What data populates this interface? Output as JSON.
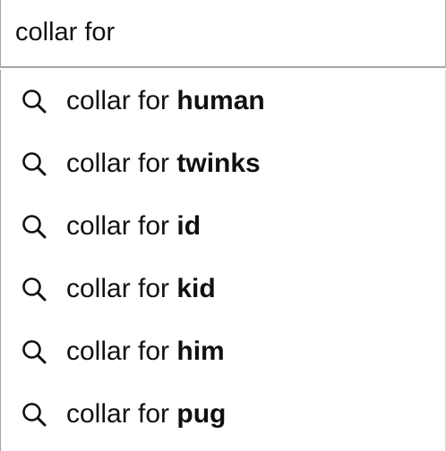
{
  "search": {
    "value": "collar for",
    "placeholder": ""
  },
  "suggestions": [
    {
      "prefix": "collar for ",
      "completion": "human",
      "icon": "search-icon"
    },
    {
      "prefix": "collar for ",
      "completion": "twinks",
      "icon": "search-icon"
    },
    {
      "prefix": "collar for ",
      "completion": "id",
      "icon": "search-icon"
    },
    {
      "prefix": "collar for ",
      "completion": "kid",
      "icon": "search-icon"
    },
    {
      "prefix": "collar for ",
      "completion": "him",
      "icon": "search-icon"
    },
    {
      "prefix": "collar for ",
      "completion": "pug",
      "icon": "search-icon"
    }
  ],
  "colors": {
    "text": "#0f1111",
    "border": "#a6a6a6",
    "background": "#ffffff"
  }
}
